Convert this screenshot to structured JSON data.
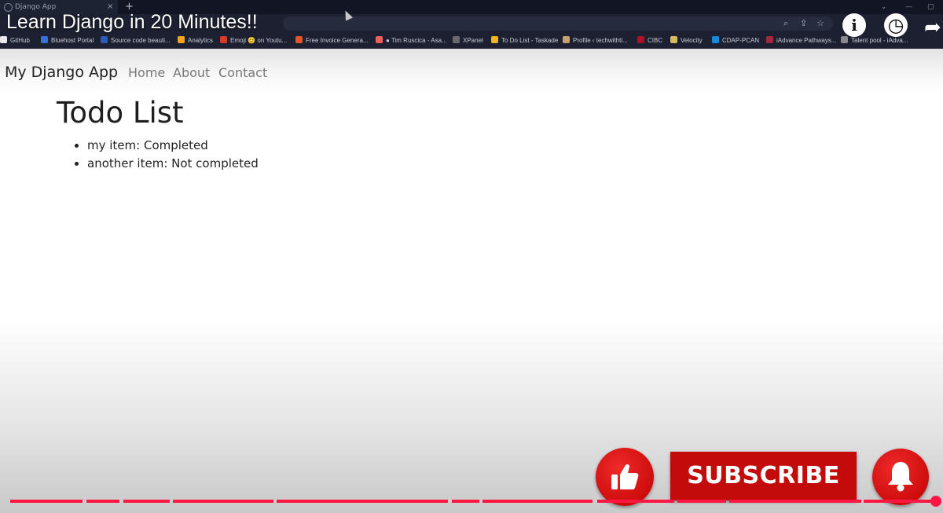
{
  "browser": {
    "tab_title": "Django App",
    "tab_close": "×",
    "new_tab": "+",
    "window_controls": [
      "⌄",
      "—",
      "▢"
    ],
    "address_icons": [
      "⌕",
      "⇪",
      "☆"
    ],
    "bookmarks": [
      {
        "label": "GitHub",
        "color": "#e8e8e8"
      },
      {
        "label": "Bluehost Portal",
        "color": "#3b6fd8"
      },
      {
        "label": "Source code beauti...",
        "color": "#2a5bb8"
      },
      {
        "label": "Analytics",
        "color": "#f4a51c"
      },
      {
        "label": "Emoji 😊 on Youtu...",
        "color": "#d83a2a"
      },
      {
        "label": "Free Invoice Genera...",
        "color": "#e0562a"
      },
      {
        "label": "● Tim Ruscica - Asa...",
        "color": "#e8625a"
      },
      {
        "label": "XPanel",
        "color": "#6a6a6a"
      },
      {
        "label": "To Do List - Taskade",
        "color": "#f0b41c"
      },
      {
        "label": "Profile ‹ techwithti...",
        "color": "#c8a070"
      },
      {
        "label": "CIBC",
        "color": "#b0102a"
      },
      {
        "label": "Velocity",
        "color": "#d8b860"
      },
      {
        "label": "CDAP-PCAN",
        "color": "#1a8ad8"
      },
      {
        "label": "iAdvance Pathways...",
        "color": "#a02a3a"
      },
      {
        "label": "Talent pool - iAdva...",
        "color": "#8a8a8a"
      }
    ]
  },
  "video": {
    "title": "Learn Django in 20 Minutes!!",
    "info_icon_text": "i",
    "watch_later_icon_text": "◷",
    "share_icon_text": "➦",
    "subscribe_label": "SUBSCRIBE",
    "accent_color": "#ff1744"
  },
  "app": {
    "brand": "My Django App",
    "nav": [
      "Home",
      "About",
      "Contact"
    ],
    "page_title": "Todo List",
    "todos": [
      "my item: Completed",
      "another item: Not completed"
    ]
  }
}
